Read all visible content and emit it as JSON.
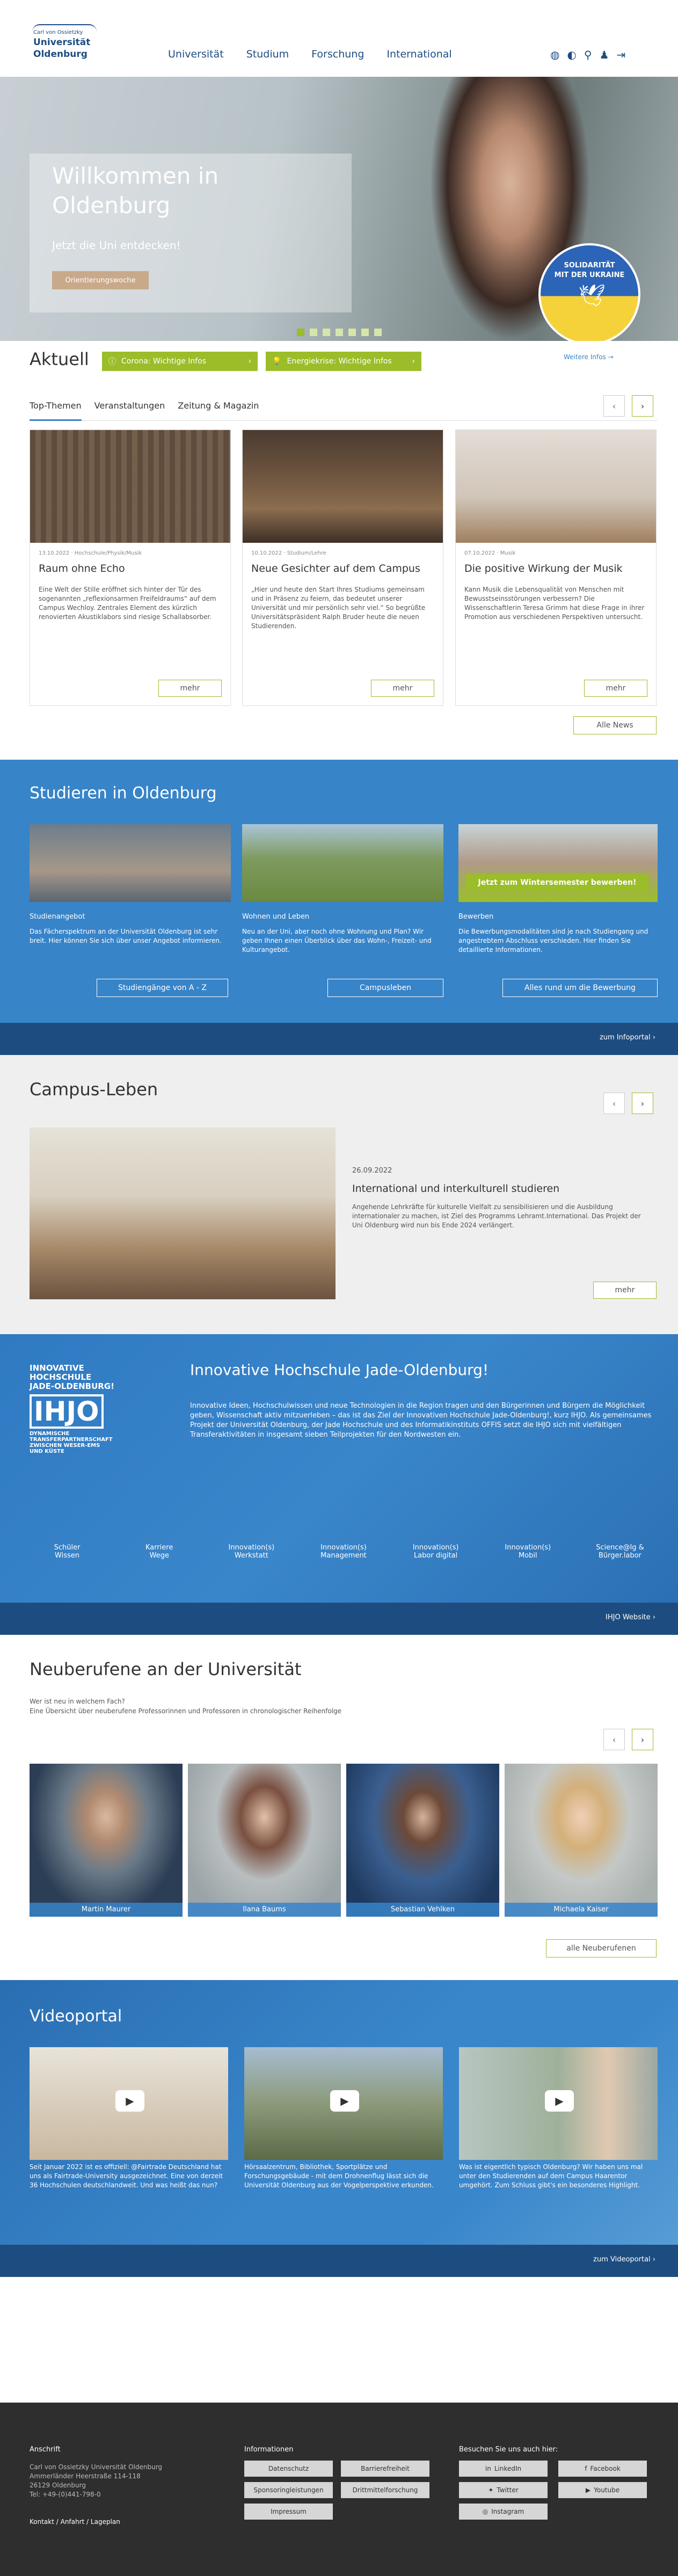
{
  "header": {
    "logo_small": "Carl von Ossietzky",
    "logo_line1": "Universität",
    "logo_line2": "Oldenburg",
    "nav": [
      "Universität",
      "Studium",
      "Forschung",
      "International"
    ]
  },
  "hero": {
    "title_line1": "Willkommen in",
    "title_line2": "Oldenburg",
    "subtitle": "Jetzt die Uni entdecken!",
    "cta": "Orientierungswoche",
    "ukraine_line1": "SOLIDARITÄT",
    "ukraine_line2": "MIT DER UKRAINE",
    "ukraine_more": "Weitere Infos →"
  },
  "aktuell": {
    "title": "Aktuell",
    "corona": "Corona: Wichtige Infos",
    "energie": "Energiekrise: Wichtige Infos",
    "tabs": [
      "Top-Themen",
      "Veranstaltungen",
      "Zeitung & Magazin"
    ],
    "cards": [
      {
        "meta": "13.10.2022 · Hochschule/Physik/Musik",
        "title": "Raum ohne Echo",
        "text": "Eine Welt der Stille eröffnet sich hinter der Tür des sogenannten „reflexionsarmen Freifeldraums“ auf dem Campus Wechloy. Zentrales Element des kürzlich renovierten Akustiklabors sind riesige Schallabsorber.",
        "more": "mehr"
      },
      {
        "meta": "10.10.2022 · Studium/Lehre",
        "title": "Neue Gesichter auf dem Campus",
        "text": "„Hier und heute den Start Ihres Studiums gemeinsam und in Präsenz zu feiern, das bedeutet unserer Universität und mir persönlich sehr viel.“ So begrüßte Universitätspräsident Ralph Bruder heute die neuen Studierenden.",
        "more": "mehr"
      },
      {
        "meta": "07.10.2022 · Musik",
        "title": "Die positive Wirkung der Musik",
        "text": "Kann Musik die Lebensqualität von Menschen mit Bewusstseinsstörungen verbessern? Die Wissenschaftlerin Teresa Grimm hat diese Frage in ihrer Promotion aus verschiedenen Perspektiven untersucht.",
        "more": "mehr"
      }
    ],
    "all": "Alle News"
  },
  "studieren": {
    "title": "Studieren in Oldenburg",
    "cols": [
      {
        "head": "Studienangebot",
        "text": "Das Fächerspektrum an der Universität Oldenburg ist sehr breit. Hier können Sie sich über unser Angebot informieren.",
        "btn": "Studiengänge von A - Z"
      },
      {
        "head": "Wohnen und Leben",
        "text": "Neu an der Uni, aber noch ohne Wohnung und Plan? Wir geben Ihnen einen Überblick über das Wohn-, Freizeit- und Kulturangebot.",
        "btn": "Campusleben"
      },
      {
        "head": "Bewerben",
        "text": "Die Bewerbungsmodalitäten sind je nach Studiengang und angestrebtem Abschluss verschieden. Hier finden Sie detaillierte Informationen.",
        "btn": "Alles rund um die Bewerbung"
      }
    ],
    "banner": "Jetzt zum Wintersemester bewerben!",
    "info": "zum Infoportal"
  },
  "campus": {
    "title": "Campus-Leben",
    "date": "26.09.2022",
    "head": "International und interkulturell studieren",
    "text": "Angehende Lehrkräfte für kulturelle Vielfalt zu sensibilisieren und die Ausbildung internationaler zu machen, ist Ziel des Programms Lehramt.International. Das Projekt der Uni Oldenburg wird nun bis Ende 2024 verlängert.",
    "more": "mehr"
  },
  "ihjo": {
    "logo_line1": "INNOVATIVE",
    "logo_line2": "HOCHSCHULE",
    "logo_line3": "JADE-OLDENBURG!",
    "logo_big": "IHJO",
    "logo_sub1": "DYNAMISCHE",
    "logo_sub2": "TRANSFERPARTNERSCHAFT",
    "logo_sub3": "ZWISCHEN WESER-EMS",
    "logo_sub4": "UND KÜSTE",
    "title": "Innovative Hochschule Jade-Oldenburg!",
    "text": "Innovative Ideen, Hochschulwissen und neue Technologien in die Region tragen und den Bürgerinnen und Bürgern die Möglichkeit geben, Wissenschaft aktiv mitzuerleben – das ist das Ziel der Innovativen Hochschule Jade-Oldenburg!, kurz IHJO. Als gemeinsames Projekt der Universität Oldenburg, der Jade Hochschule und des Informatikinstituts OFFIS setzt die IHJO sich mit vielfältigen Transferaktivitäten in insgesamt sieben Teilprojekten für den Nordwesten ein.",
    "items": [
      {
        "l1": "Schüler",
        "l2": "Wissen"
      },
      {
        "l1": "Karriere",
        "l2": "Wege"
      },
      {
        "l1": "Innovation(s)",
        "l2": "Werkstatt"
      },
      {
        "l1": "Innovation(s)",
        "l2": "Management"
      },
      {
        "l1": "Innovation(s)",
        "l2": "Labor digital"
      },
      {
        "l1": "Innovation(s)",
        "l2": "Mobil"
      },
      {
        "l1": "Science@Ig &",
        "l2": "Bürger.labor"
      }
    ],
    "link": "IHJO Website"
  },
  "neu": {
    "title": "Neuberufene an der Universität",
    "line1": "Wer ist neu in welchem Fach?",
    "line2": "Eine Übersicht über neuberufene Professorinnen und Professoren in chronologischer Reihenfolge",
    "people": [
      "Martin Maurer",
      "Ilana Baums",
      "Sebastian Vehlken",
      "Michaela Kaiser"
    ],
    "all": "alle Neuberufenen"
  },
  "video": {
    "title": "Videoportal",
    "items": [
      "Seit Januar 2022 ist es offiziell: @Fairtrade Deutschland hat uns als Fairtrade-University ausgezeichnet. Eine von derzeit 36 Hochschulen deutschlandweit. Und was heißt das nun?",
      "Hörsaalzentrum, Bibliothek, Sportplätze und Forschungsgebäude - mit dem Drohnenflug lässt sich die Universität Oldenburg aus der Vogelperspektive erkunden.",
      "Was ist eigentlich typisch Oldenburg? Wir haben uns mal unter den Studierenden auf dem Campus Haarentor umgehört. Zum Schluss gibt's ein besonderes Highlight."
    ],
    "link": "zum Videoportal"
  },
  "footer": {
    "h1": "Anschrift",
    "addr": [
      "Carl von Ossietzky Universität Oldenburg",
      "Ammerländer Heerstraße 114-118",
      "26129 Oldenburg",
      "Tel: +49-(0)441-798-0"
    ],
    "contact": "Kontakt / Anfahrt / Lageplan",
    "h2": "Informationen",
    "info": [
      "Datenschutz",
      "Barrierefreiheit",
      "Sponsoringleistungen",
      "Drittmittelforschung",
      "Impressum"
    ],
    "h3": "Besuchen Sie uns auch hier:",
    "social": [
      "LinkedIn",
      "Facebook",
      "Twitter",
      "Youtube",
      "Instagram"
    ]
  },
  "colors": {
    "accent": "#9bbd2a",
    "blue": "#3784c9",
    "darkblue": "#1d4d80",
    "footer": "#2e2e2e"
  }
}
